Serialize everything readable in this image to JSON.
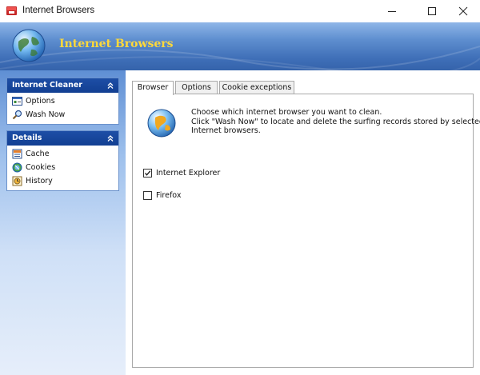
{
  "window": {
    "title": "Internet Browsers",
    "controls": [
      "minimize",
      "maximize",
      "close"
    ]
  },
  "banner": {
    "title": "Internet Browsers",
    "icon": "globe-icon"
  },
  "sidebar": {
    "groups": [
      {
        "header": "Internet Cleaner",
        "items": [
          {
            "label": "Options",
            "icon": "options-icon"
          },
          {
            "label": "Wash Now",
            "icon": "magnifier-icon"
          }
        ]
      },
      {
        "header": "Details",
        "items": [
          {
            "label": "Cache",
            "icon": "cache-icon"
          },
          {
            "label": "Cookies",
            "icon": "cookies-icon"
          },
          {
            "label": "History",
            "icon": "history-icon"
          }
        ]
      }
    ]
  },
  "tabs": [
    {
      "label": "Browser",
      "active": true
    },
    {
      "label": "Options",
      "active": false
    },
    {
      "label": "Cookie exceptions",
      "active": false
    }
  ],
  "browser_tab": {
    "description": [
      "Choose which internet browser you want to clean.",
      "Click \"Wash Now\" to locate and delete the surfing records stored by selected",
      "Internet browsers."
    ],
    "options": [
      {
        "label": "Internet Explorer",
        "checked": true
      },
      {
        "label": "Firefox",
        "checked": false
      }
    ]
  },
  "colors": {
    "banner_title": "#ffd93a",
    "group_header": "#1d4ea6",
    "banner_bg": "#3f6fb8"
  }
}
